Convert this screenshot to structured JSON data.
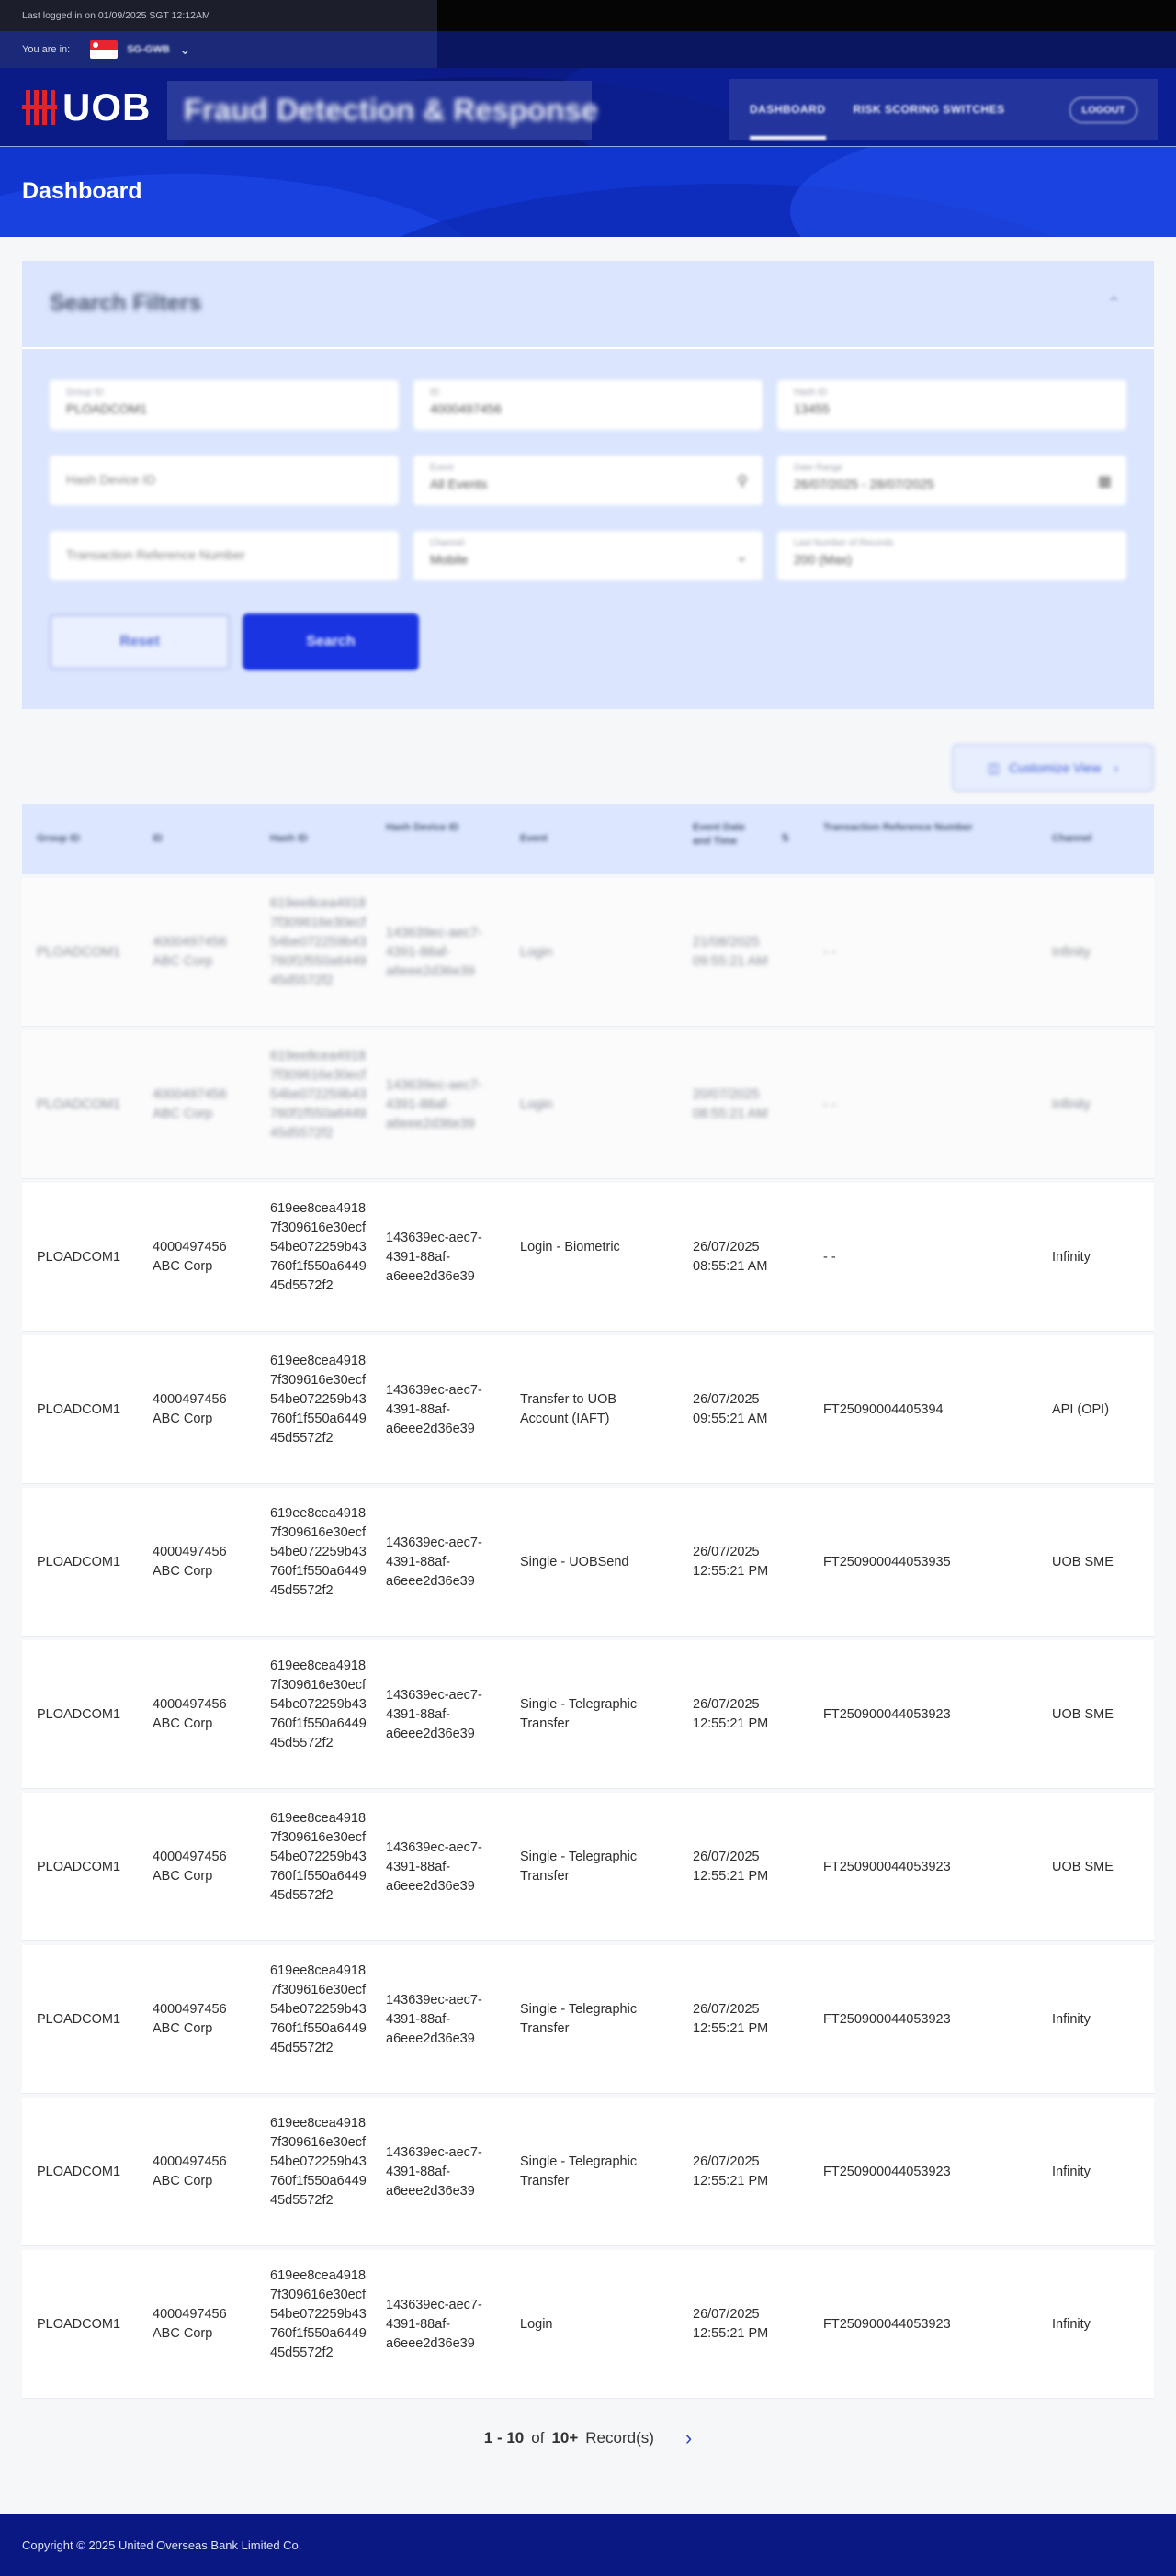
{
  "session": {
    "last_login": "Last logged in on 01/09/2025 SGT 12:12AM"
  },
  "location": {
    "label": "You are in:",
    "code": "SG-GWB"
  },
  "header": {
    "brand": "UOB",
    "app_title": "Fraud Detection & Response",
    "nav": [
      {
        "label": "DASHBOARD",
        "active": true
      },
      {
        "label": "RISK SCORING SWITCHES",
        "active": false
      }
    ],
    "logout": "LOGOUT"
  },
  "page": {
    "title": "Dashboard"
  },
  "filters": {
    "title": "Search Filters",
    "fields": [
      {
        "label": "Group ID",
        "value": "PLOADCOM1"
      },
      {
        "label": "ID",
        "value": "4000497456"
      },
      {
        "label": "Hash ID",
        "value": "13455"
      },
      {
        "label": "",
        "value": "Hash Device ID"
      },
      {
        "label": "Event",
        "value": "All Events"
      },
      {
        "label": "Date Range",
        "value": "26/07/2025 - 28/07/2025"
      },
      {
        "label": "",
        "value": "Transaction Reference Number"
      },
      {
        "label": "Channel",
        "value": "Mobile"
      },
      {
        "label": "Last Number of Records",
        "value": "200 (Max)"
      }
    ],
    "reset": "Reset",
    "search": "Search"
  },
  "column_view": "Customize View",
  "table": {
    "headers": [
      "Group ID",
      "ID",
      "Hash ID",
      "Hash Device ID",
      "Event",
      "Event Date and Time",
      "Transaction Reference Number",
      "Channel"
    ],
    "rows": [
      {
        "faded": true,
        "group": "PLOADCOM1",
        "id": "4000497456 ABC Corp",
        "hash": "619ee8cea49187f309616e30ecf54be072259b43760f1f550a644945d5572f2",
        "device": "143639ec-aec7-4391-88af-a6eee2d36e39",
        "event": "Login",
        "date": "21/08/2025 09:55:21 AM",
        "ref": "- -",
        "channel": "Infinity"
      },
      {
        "faded": true,
        "group": "PLOADCOM1",
        "id": "4000497456 ABC Corp",
        "hash": "619ee8cea49187f309616e30ecf54be072259b43760f1f550a644945d5572f2",
        "device": "143639ec-aec7-4391-88af-a6eee2d36e39",
        "event": "Login",
        "date": "20/07/2025 08:55:21 AM",
        "ref": "- -",
        "channel": "Infinity"
      },
      {
        "faded": false,
        "group": "PLOADCOM1",
        "id": "4000497456 ABC Corp",
        "hash": "619ee8cea49187f309616e30ecf54be072259b43760f1f550a644945d5572f2",
        "device": "143639ec-aec7-4391-88af-a6eee2d36e39",
        "event": "Login - Biometric",
        "date": "26/07/2025 08:55:21 AM",
        "ref": "- -",
        "channel": "Infinity"
      },
      {
        "faded": false,
        "group": "PLOADCOM1",
        "id": "4000497456 ABC Corp",
        "hash": "619ee8cea49187f309616e30ecf54be072259b43760f1f550a644945d5572f2",
        "device": "143639ec-aec7-4391-88af-a6eee2d36e39",
        "event": "Transfer to UOB Account (IAFT)",
        "date": "26/07/2025 09:55:21 AM",
        "ref": "FT25090004405394",
        "channel": "API (OPI)"
      },
      {
        "faded": false,
        "group": "PLOADCOM1",
        "id": "4000497456 ABC Corp",
        "hash": "619ee8cea49187f309616e30ecf54be072259b43760f1f550a644945d5572f2",
        "device": "143639ec-aec7-4391-88af-a6eee2d36e39",
        "event": "Single - UOBSend",
        "date": "26/07/2025 12:55:21 PM",
        "ref": "FT250900044053935",
        "channel": "UOB SME"
      },
      {
        "faded": false,
        "group": "PLOADCOM1",
        "id": "4000497456 ABC Corp",
        "hash": "619ee8cea49187f309616e30ecf54be072259b43760f1f550a644945d5572f2",
        "device": "143639ec-aec7-4391-88af-a6eee2d36e39",
        "event": "Single - Telegraphic Transfer",
        "date": "26/07/2025 12:55:21 PM",
        "ref": "FT250900044053923",
        "channel": "UOB SME"
      },
      {
        "faded": false,
        "group": "PLOADCOM1",
        "id": "4000497456 ABC Corp",
        "hash": "619ee8cea49187f309616e30ecf54be072259b43760f1f550a644945d5572f2",
        "device": "143639ec-aec7-4391-88af-a6eee2d36e39",
        "event": "Single - Telegraphic Transfer",
        "date": "26/07/2025 12:55:21 PM",
        "ref": "FT250900044053923",
        "channel": "UOB SME"
      },
      {
        "faded": false,
        "group": "PLOADCOM1",
        "id": "4000497456 ABC Corp",
        "hash": "619ee8cea49187f309616e30ecf54be072259b43760f1f550a644945d5572f2",
        "device": "143639ec-aec7-4391-88af-a6eee2d36e39",
        "event": "Single - Telegraphic Transfer",
        "date": "26/07/2025 12:55:21 PM",
        "ref": "FT250900044053923",
        "channel": "Infinity"
      },
      {
        "faded": false,
        "group": "PLOADCOM1",
        "id": "4000497456 ABC Corp",
        "hash": "619ee8cea49187f309616e30ecf54be072259b43760f1f550a644945d5572f2",
        "device": "143639ec-aec7-4391-88af-a6eee2d36e39",
        "event": "Single - Telegraphic Transfer",
        "date": "26/07/2025 12:55:21 PM",
        "ref": "FT250900044053923",
        "channel": "Infinity"
      },
      {
        "faded": false,
        "group": "PLOADCOM1",
        "id": "4000497456 ABC Corp",
        "hash": "619ee8cea49187f309616e30ecf54be072259b43760f1f550a644945d5572f2",
        "device": "143639ec-aec7-4391-88af-a6eee2d36e39",
        "event": "Login",
        "date": "26/07/2025 12:55:21 PM",
        "ref": "FT250900044053923",
        "channel": "Infinity"
      }
    ]
  },
  "pagination": {
    "range": "1 - 10",
    "of": "of",
    "total": "10+",
    "suffix": "Record(s)"
  },
  "footer": {
    "copyright": "Copyright © 2025 United Overseas Bank Limited Co."
  }
}
